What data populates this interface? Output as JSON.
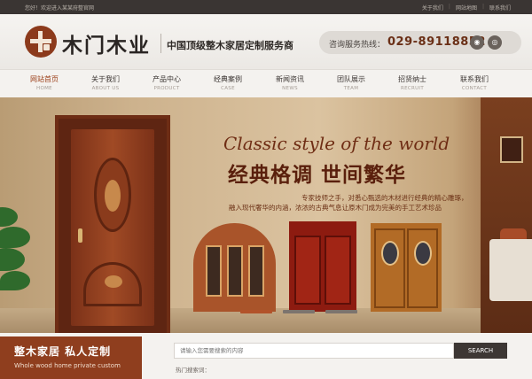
{
  "topbar": {
    "welcome": "您好！欢迎进入某某府整官网",
    "links": [
      "关于我们",
      "网站地图",
      "联系我们"
    ]
  },
  "header": {
    "logo_text": "木门木业",
    "slogan": "中国顶级整木家居定制服务商",
    "hotline_label": "咨询服务热线：",
    "hotline_number": "029-89118852",
    "icons": [
      "weibo-icon",
      "wechat-icon"
    ]
  },
  "nav": {
    "items": [
      {
        "zh": "网站首页",
        "en": "HOME"
      },
      {
        "zh": "关于我们",
        "en": "ABOUT US"
      },
      {
        "zh": "产品中心",
        "en": "PRODUCT"
      },
      {
        "zh": "经典案例",
        "en": "CASE"
      },
      {
        "zh": "新闻资讯",
        "en": "NEWS"
      },
      {
        "zh": "团队展示",
        "en": "TEAM"
      },
      {
        "zh": "招贤纳士",
        "en": "RECRUIT"
      },
      {
        "zh": "联系我们",
        "en": "CONTACT"
      }
    ]
  },
  "banner": {
    "tagline_en": "Classic style of the world",
    "tagline_zh": "经典格调 世间繁华",
    "desc_line1": "专家技师之手，对悉心甄选的木材进行经典的精心雕琢，",
    "desc_line2": "融入现代奢华的内涵，浓浓的古典气息让原木门成为完美的手工艺术珍品",
    "slide_count": 3,
    "active_slide": 0
  },
  "promo": {
    "title_zh": "整木家居  私人定制",
    "title_en": "Whole wood  home private custom"
  },
  "search": {
    "placeholder": "请输入您需要搜索的内容",
    "button": "SEARCH",
    "hot_label": "热门搜索词："
  },
  "colors": {
    "brand": "#8f3e1e",
    "topbar": "#3a3533",
    "hotline_number": "#6a2f16"
  }
}
